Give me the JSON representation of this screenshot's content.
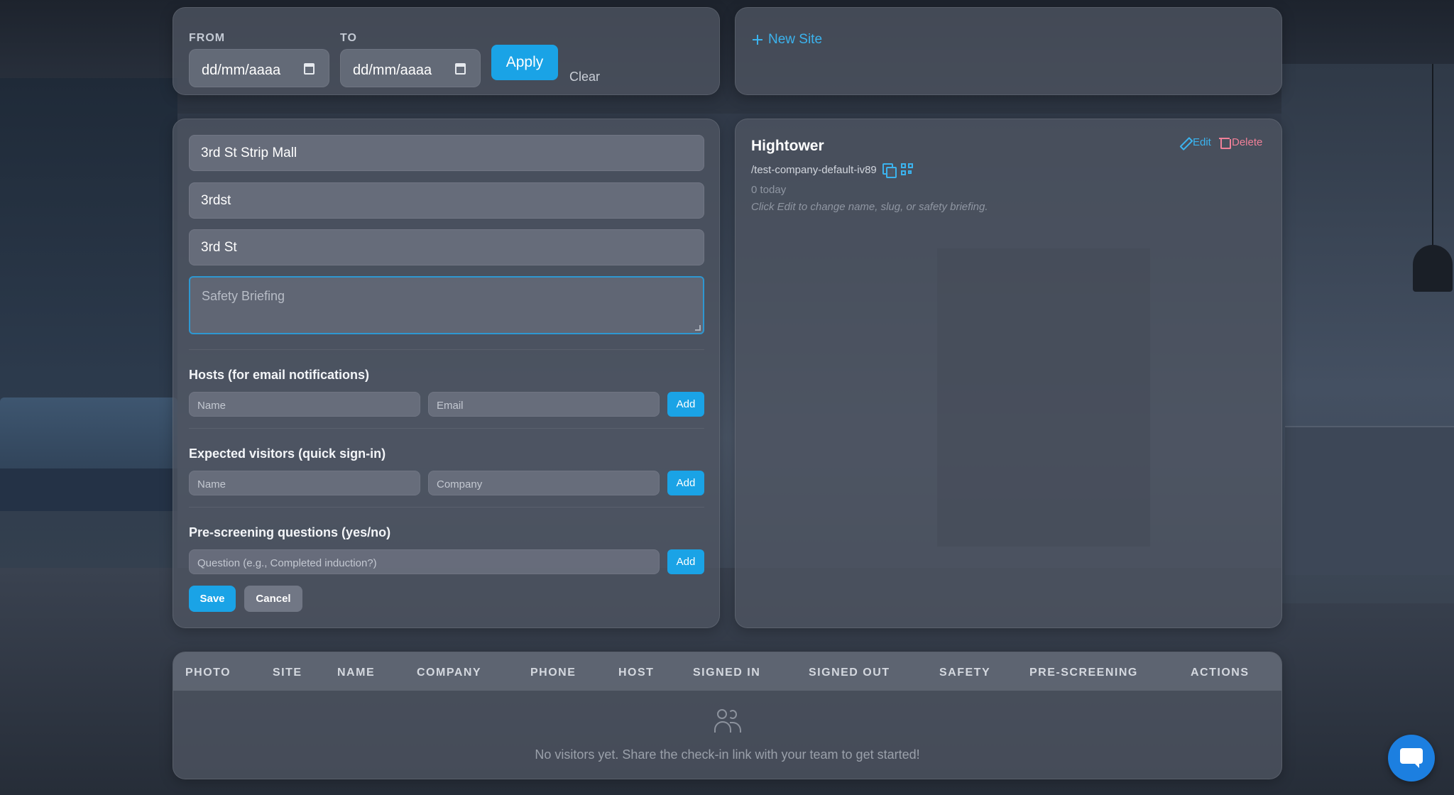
{
  "filter": {
    "from_label": "FROM",
    "to_label": "TO",
    "from_value": "dd/mm/aaaa",
    "to_value": "dd/mm/aaaa",
    "apply_label": "Apply",
    "clear_label": "Clear"
  },
  "new_site": {
    "label": "New Site"
  },
  "edit_form": {
    "site_name": "3rd St Strip Mall",
    "slug": "3rdst",
    "short_name": "3rd St",
    "safety_briefing_placeholder": "Safety Briefing",
    "hosts": {
      "title": "Hosts (for email notifications)",
      "name_placeholder": "Name",
      "email_placeholder": "Email",
      "add_label": "Add"
    },
    "expected": {
      "title": "Expected visitors (quick sign-in)",
      "name_placeholder": "Name",
      "company_placeholder": "Company",
      "add_label": "Add"
    },
    "prescreen": {
      "title": "Pre-screening questions (yes/no)",
      "question_placeholder": "Question (e.g., Completed induction?)",
      "add_label": "Add"
    },
    "save_label": "Save",
    "cancel_label": "Cancel"
  },
  "site_card": {
    "name": "Hightower",
    "slug": "/test-company-default-iv89",
    "count": "0 today",
    "hint": "Click Edit to change name, slug, or safety briefing.",
    "edit_label": "Edit",
    "delete_label": "Delete"
  },
  "table": {
    "columns": [
      "PHOTO",
      "SITE",
      "NAME",
      "COMPANY",
      "PHONE",
      "HOST",
      "SIGNED IN",
      "SIGNED OUT",
      "SAFETY",
      "PRE-SCREENING",
      "ACTIONS"
    ],
    "empty_message": "No visitors yet. Share the check-in link with your team to get started!"
  },
  "colors": {
    "accent": "#1aa3e6",
    "link": "#3bb3ee",
    "danger": "#f08098",
    "chat": "#1c7fe0"
  },
  "icons": [
    "calendar-icon",
    "plus-icon",
    "copy-icon",
    "qr-code-icon",
    "pencil-icon",
    "trash-icon",
    "users-icon",
    "chat-icon"
  ]
}
